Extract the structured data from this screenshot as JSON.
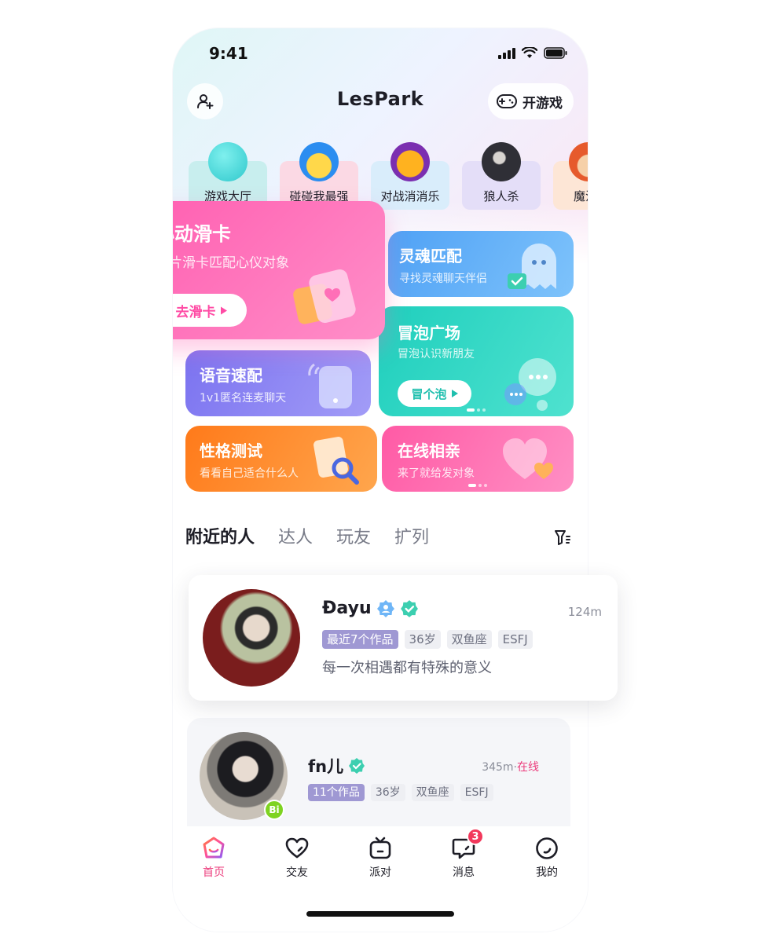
{
  "status_bar": {
    "time": "9:41"
  },
  "header": {
    "title": "LesPark",
    "game_button": "开游戏"
  },
  "games": [
    {
      "label": "游戏大厅",
      "tile": "#c6eeee",
      "icon": "#45d4d4"
    },
    {
      "label": "碰碰我最强",
      "tile": "#fbd6e2",
      "icon": "#2b8df0"
    },
    {
      "label": "对战消消乐",
      "tile": "#d6ecfb",
      "icon": "#f7a21e"
    },
    {
      "label": "狼人杀",
      "tile": "#e2dcf7",
      "icon": "#2f2f36"
    },
    {
      "label": "魔法之",
      "tile": "#fde4d2",
      "icon": "#e65a2c"
    }
  ],
  "cards": {
    "swipe": {
      "title": "心动滑卡",
      "subtitle": "照片滑卡匹配心仪对象",
      "button": "去滑卡"
    },
    "soul": {
      "title": "灵魂匹配",
      "subtitle": "寻找灵魂聊天伴侣"
    },
    "voice": {
      "title": "语音速配",
      "subtitle": "1v1匿名连麦聊天"
    },
    "bubble": {
      "title": "冒泡广场",
      "subtitle": "冒泡认识新朋友",
      "button": "冒个泡"
    },
    "personality": {
      "title": "性格测试",
      "subtitle": "看看自己适合什么人"
    },
    "dating": {
      "title": "在线相亲",
      "subtitle": "来了就给发对象"
    }
  },
  "tabs": [
    {
      "label": "附近的人",
      "active": true
    },
    {
      "label": "达人",
      "active": false
    },
    {
      "label": "玩友",
      "active": false
    },
    {
      "label": "扩列",
      "active": false
    }
  ],
  "people": [
    {
      "name": "Đayu",
      "distance": "124m",
      "tags": [
        "最近7个作品",
        "36岁",
        "双鱼座",
        "ESFJ"
      ],
      "bio": "每一次相遇都有特殊的意义"
    },
    {
      "name": "fn儿",
      "distance": "345m",
      "status": "在线",
      "badge": "Bi",
      "tags": [
        "11个作品",
        "36岁",
        "双鱼座",
        "ESFJ"
      ]
    }
  ],
  "nav": {
    "items": [
      "首页",
      "交友",
      "派对",
      "消息",
      "我的"
    ],
    "message_badge": "3"
  },
  "colors": {
    "accent": "#ec3d7d",
    "swipe_card": "#ff6fc0",
    "soul_card": "#5aa8f5",
    "voice_card": "#8a85f0",
    "bubble_card": "#2dd6c3",
    "personality_card": "#ff8a2a",
    "dating_card": "#ff6fa8",
    "verified": "#3ccfb0"
  }
}
